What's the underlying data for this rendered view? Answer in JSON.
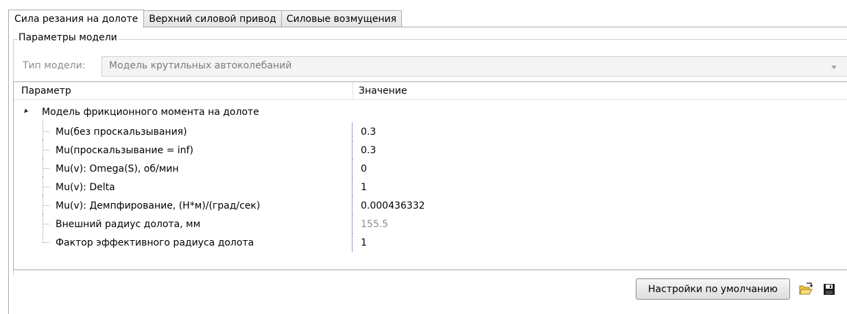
{
  "tabs": [
    {
      "label": "Сила резания на долоте",
      "active": true
    },
    {
      "label": "Верхний силовой привод",
      "active": false
    },
    {
      "label": "Силовые возмущения",
      "active": false
    }
  ],
  "model_params": {
    "group_title": "Параметры модели",
    "model_type_label": "Тип модели:",
    "model_type_value": "Модель крутильных автоколебаний"
  },
  "grid": {
    "col_param": "Параметр",
    "col_value": "Значение",
    "category": "Модель фрикционного момента на долоте",
    "rows": [
      {
        "name": "Mu(без проскальзывания)",
        "value": "0.3",
        "readonly": false
      },
      {
        "name": "Mu(проскальзывание = inf)",
        "value": "0.3",
        "readonly": false
      },
      {
        "name": "Mu(v): Omega(S), об/мин",
        "value": "0",
        "readonly": false
      },
      {
        "name": "Mu(v): Delta",
        "value": "1",
        "readonly": false
      },
      {
        "name": "Mu(v): Демпфирование, (Н*м)/(град/сек)",
        "value": "0.000436332",
        "readonly": false
      },
      {
        "name": "Внешний радиус долота, мм",
        "value": "155.5",
        "readonly": true
      },
      {
        "name": "Фактор эффективного радиуса долота",
        "value": "1",
        "readonly": false
      }
    ]
  },
  "footer": {
    "default_button_label": "Настройки по умолчанию",
    "open_icon": "folder-open-icon",
    "save_icon": "floppy-disk-icon"
  },
  "colors": {
    "tab_border": "#a9a9a9",
    "value_separator": "#3a3aa8",
    "readonly_text": "#8c8c8c"
  }
}
